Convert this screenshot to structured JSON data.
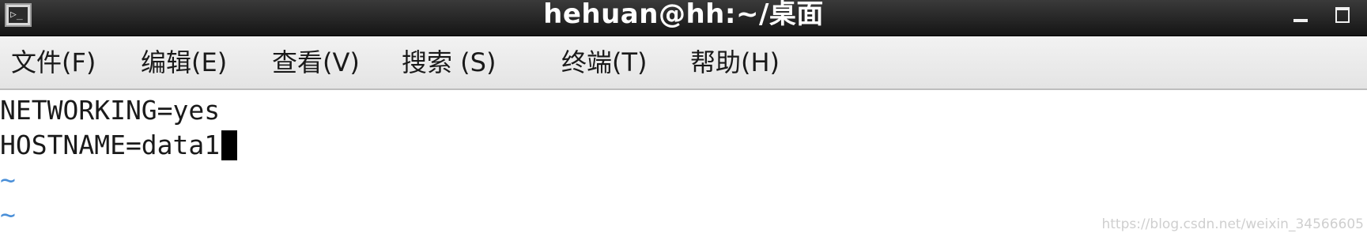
{
  "window": {
    "title": "hehuan@hh:~/桌面",
    "icon_text": "▷_",
    "icon": "terminal-icon",
    "controls": [
      "minimize-icon",
      "maximize-icon"
    ]
  },
  "menu": {
    "items": [
      {
        "label": "文件(F)"
      },
      {
        "label": "编辑(E)"
      },
      {
        "label": "查看(V)"
      },
      {
        "label": "搜索 (S)"
      },
      {
        "label": "终端(T)"
      },
      {
        "label": "帮助(H)"
      }
    ]
  },
  "editor": {
    "lines": [
      "NETWORKING=yes",
      "HOSTNAME=data1"
    ],
    "empty_line_marker": "~",
    "tilde_color": "#4a8fd8"
  },
  "watermark": "https://blog.csdn.net/weixin_34566605"
}
